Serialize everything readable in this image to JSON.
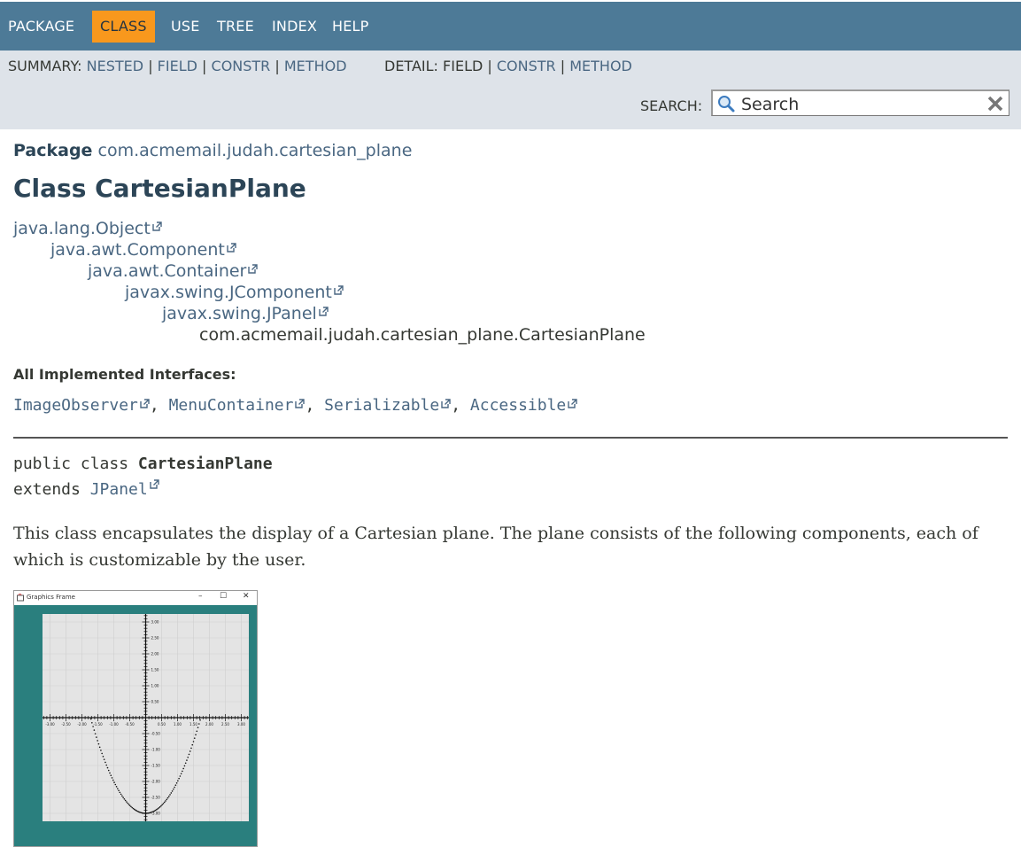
{
  "nav": {
    "items": [
      "PACKAGE",
      "CLASS",
      "USE",
      "TREE",
      "INDEX",
      "HELP"
    ],
    "active": "CLASS"
  },
  "subnav": {
    "summary_label": "SUMMARY:",
    "summary_links": [
      "NESTED",
      "FIELD",
      "CONSTR",
      "METHOD"
    ],
    "detail_label": "DETAIL:",
    "detail_field": "FIELD",
    "detail_links": [
      "CONSTR",
      "METHOD"
    ],
    "separator": "|"
  },
  "search": {
    "label": "SEARCH:",
    "placeholder": "Search"
  },
  "header": {
    "package_label": "Package",
    "package_name": "com.acmemail.judah.cartesian_plane",
    "class_title": "Class CartesianPlane"
  },
  "inheritance": [
    "java.lang.Object",
    "java.awt.Component",
    "java.awt.Container",
    "javax.swing.JComponent",
    "javax.swing.JPanel",
    "com.acmemail.judah.cartesian_plane.CartesianPlane"
  ],
  "interfaces": {
    "label": "All Implemented Interfaces:",
    "items": [
      "ImageObserver",
      "MenuContainer",
      "Serializable",
      "Accessible"
    ],
    "separator": ","
  },
  "signature": {
    "line1_prefix": "public class ",
    "class_name": "CartesianPlane",
    "line2_prefix": "extends ",
    "extends_link": "JPanel"
  },
  "description": "This class encapsulates the display of a Cartesian plane. The plane consists of the following components, each of which is customizable by the user.",
  "screenshot": {
    "window_title": "Graphics Frame",
    "minimize": "–",
    "maximize": "☐",
    "close": "✕",
    "x_tick_labels": [
      "-3.00",
      "-2.50",
      "-2.00",
      "-1.50",
      "-1.00",
      "-0.50",
      "0.50",
      "1.00",
      "1.50",
      "2.00",
      "2.50",
      "3.00"
    ],
    "y_tick_labels": [
      "3.00",
      "2.50",
      "2.00",
      "1.50",
      "1.00",
      "0.50",
      "-0.50",
      "-1.00",
      "-1.50",
      "-2.00",
      "-2.50",
      "-3.00"
    ]
  },
  "colors": {
    "nav_bg": "#4d7a97",
    "active_tab": "#f8981d",
    "subnav_bg": "#dee3e9",
    "link": "#4a6782",
    "heading": "#2c4557",
    "window_bg": "#2a7f7e"
  }
}
